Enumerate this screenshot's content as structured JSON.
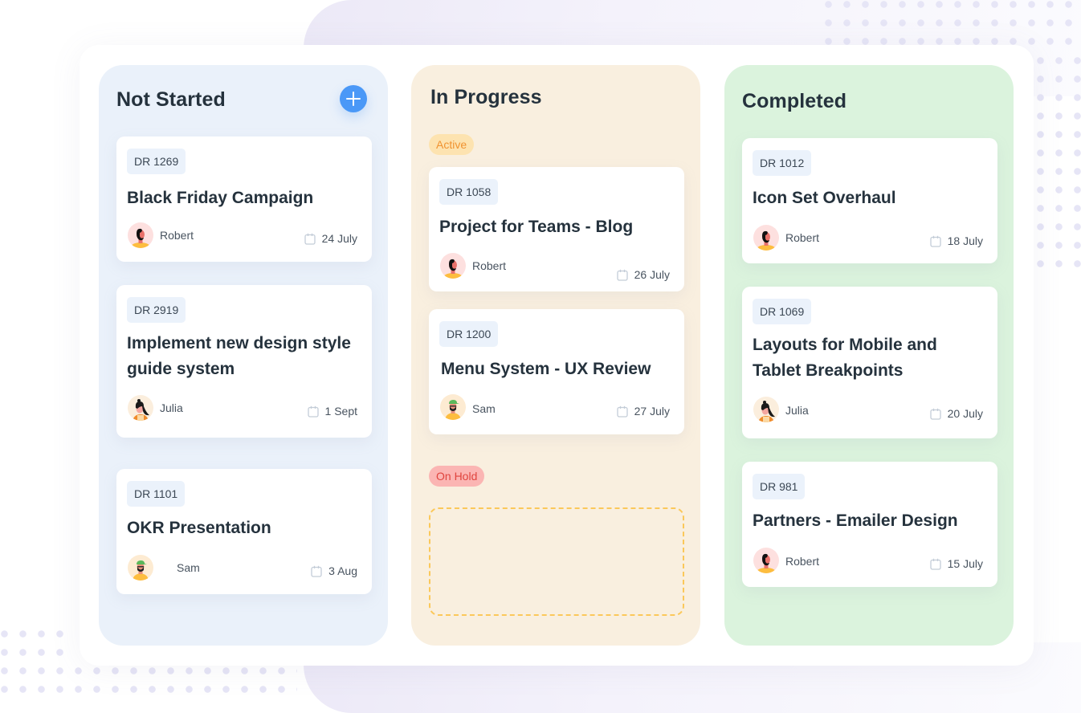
{
  "columns": [
    {
      "title": "Not Started",
      "add_button_label": "+",
      "cards": [
        {
          "id": "DR 1269",
          "title": "Black Friday Campaign",
          "assignee": "Robert",
          "avatar": "robert",
          "due": "24 July"
        },
        {
          "id": "DR 2919",
          "title": "Implement new design style guide system",
          "assignee": "Julia",
          "avatar": "julia",
          "due": "1 Sept"
        },
        {
          "id": "DR 1101",
          "title": "OKR Presentation",
          "assignee": "Sam",
          "avatar": "sam",
          "due": "3 Aug"
        }
      ]
    },
    {
      "title": "In Progress",
      "groups": [
        {
          "status": "Active",
          "cards": [
            {
              "id": "DR 1058",
              "title": "Project for Teams - Blog",
              "assignee": "Robert",
              "avatar": "robert",
              "due": "26 July"
            },
            {
              "id": "DR 1200",
              "title": "Menu System - UX Review",
              "assignee": "Sam",
              "avatar": "sam",
              "due": "27 July"
            }
          ]
        },
        {
          "status": "On Hold",
          "cards": []
        }
      ]
    },
    {
      "title": "Completed",
      "cards": [
        {
          "id": "DR 1012",
          "title": "Icon Set Overhaul",
          "assignee": "Robert",
          "avatar": "robert",
          "due": "18 July"
        },
        {
          "id": "DR 1069",
          "title": "Layouts for Mobile and Tablet Breakpoints",
          "assignee": "Julia",
          "avatar": "julia",
          "due": "20 July"
        },
        {
          "id": "DR 981",
          "title": "Partners - Emailer Design",
          "assignee": "Robert",
          "avatar": "robert",
          "due": "15 July"
        }
      ]
    }
  ],
  "icons": {
    "add": "plus-icon",
    "due_date": "calendar-icon"
  },
  "colors": {
    "accent": "#4a98f7",
    "not_started_bg": "#eaf1fa",
    "in_progress_bg": "#f9efdf",
    "completed_bg": "#dbf3dd",
    "active_pill": "#fde3b0",
    "active_text": "#f09330",
    "on_hold_pill": "#fbb5b3",
    "on_hold_text": "#e0443e",
    "dropzone_border": "#fbc85a"
  }
}
